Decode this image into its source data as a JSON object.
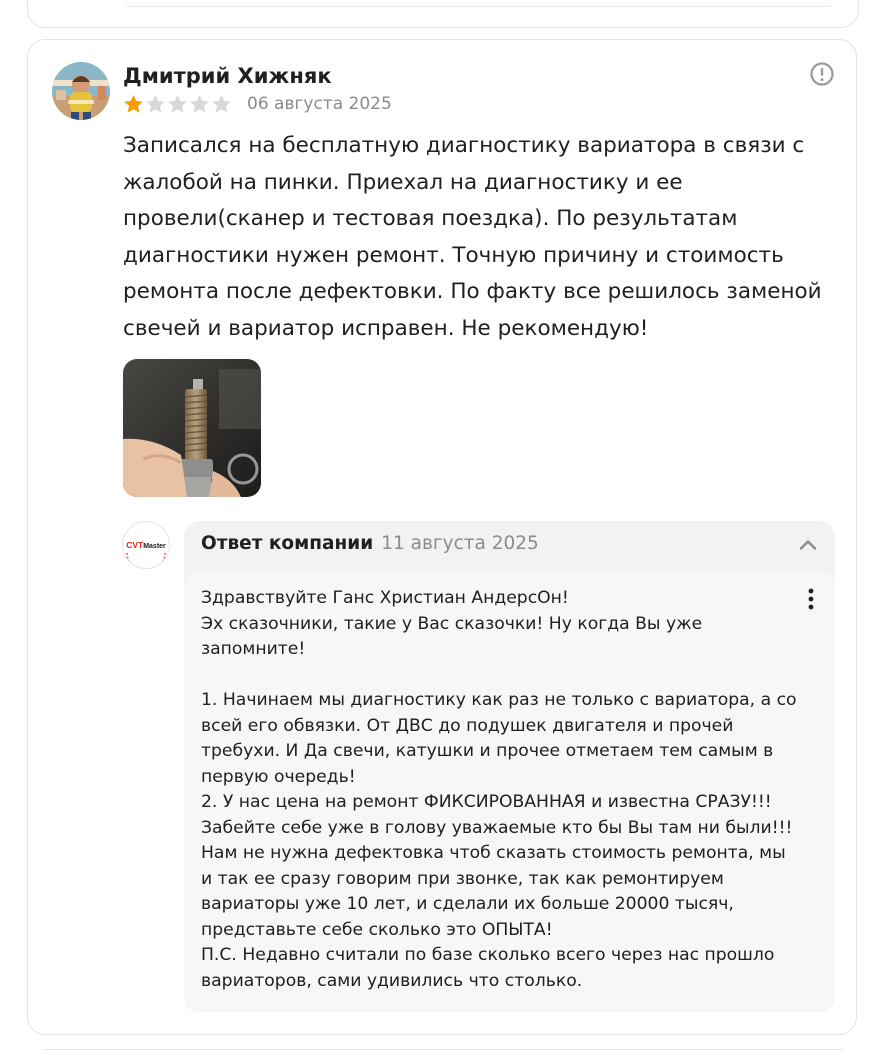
{
  "review": {
    "author": "Дмитрий Хижняк",
    "rating": 1,
    "rating_max": 5,
    "date": "06 августа 2025",
    "text": "Записался на бесплатную диагностику вариатора в связи с жалобой на пинки. Приехал на диагностику и ее провели(сканер и тестовая поездка). По результатам диагностики нужен ремонт. Точную причину и стоимость ремонта после дефектовки. По факту все решилось заменой свечей и вариатор исправен. Не рекомендую!",
    "photo_icon": "spark-plug-photo",
    "actions": {
      "report_icon": "alert-circle-icon"
    }
  },
  "company_reply": {
    "logo_text": "CVT Master",
    "title": "Ответ компании",
    "date": "11 августа 2025",
    "collapse_icon": "chevron-up-icon",
    "menu_icon": "more-vertical-icon",
    "paragraphs": [
      "Здравствуйте Ганс Христиан АндерсОн!",
      "Эх сказочники, такие у Вас сказочки! Ну когда Вы уже запомните!",
      "",
      "1. Начинаем мы диагностику как раз не только с вариатора, а со всей его обвязки. От ДВС до подушек двигателя и прочей требухи. И Да свечи, катушки и прочее отметаем тем самым в первую очередь!",
      "2. У нас цена на ремонт ФИКСИРОВАННАЯ и известна СРАЗУ!!! Забейте себе уже в голову уважаемые кто бы Вы там ни были!!! Нам не нужна дефектовка чтоб сказать стоимость ремонта, мы и так ее сразу говорим при звонке, так как ремонтируем вариаторы уже 10 лет, и сделали их больше 20000 тысяч, представьте себе сколько это ОПЫТА!",
      "П.С. Недавно считали по базе сколько всего через нас прошло вариаторов, сами удивились что столько."
    ]
  },
  "colors": {
    "star_filled": "#fc9a00",
    "star_empty": "#d8d8d8",
    "muted_text": "#8b8b8b",
    "answer_bg": "#f2f2f2",
    "logo_red": "#e2231a"
  }
}
